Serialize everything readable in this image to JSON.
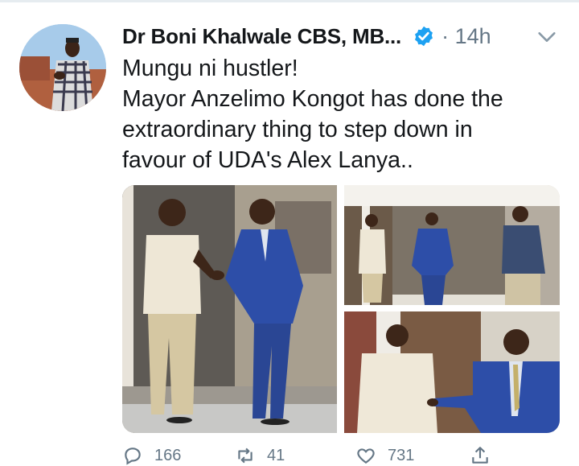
{
  "tweet": {
    "author_name": "Dr Boni Khalwale CBS, MB...",
    "time": "14h",
    "text_lines": [
      "Mungu ni hustler!",
      "Mayor Anzelimo Kongot has done the",
      "extraordinary thing to step down in",
      "favour of UDA's Alex Lanya.."
    ],
    "counts": {
      "replies": "166",
      "retweets": "41",
      "likes": "731"
    }
  },
  "icons": {
    "verified": "verified-badge-icon",
    "menu": "chevron-down-icon",
    "reply": "reply-icon",
    "retweet": "retweet-icon",
    "like": "heart-icon",
    "share": "share-icon"
  },
  "colors": {
    "verified": "#1da1f2",
    "secondary_text": "#657786",
    "text": "#14171a"
  }
}
